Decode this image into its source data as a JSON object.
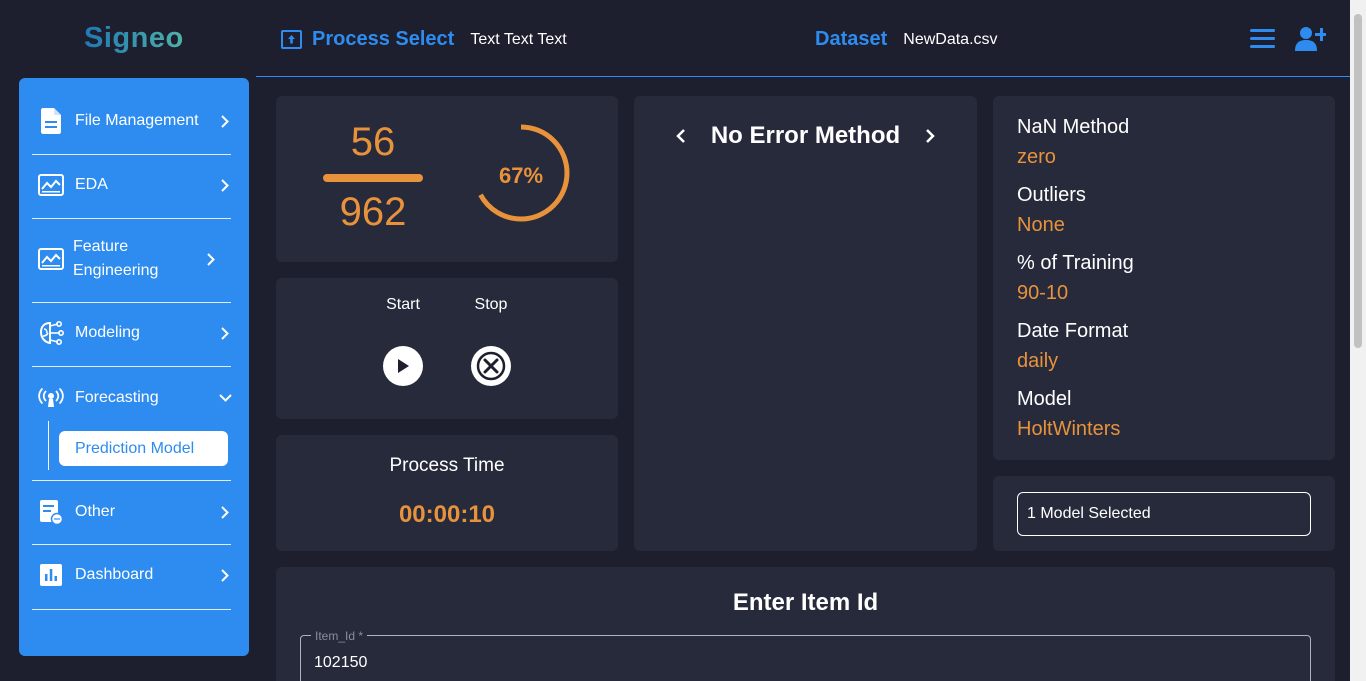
{
  "header": {
    "logo": "Signeo",
    "process_title": "Process Select",
    "process_sub": "Text Text Text",
    "dataset_label": "Dataset",
    "dataset_value": "NewData.csv",
    "menu_icon": "hamburger-menu-icon",
    "user_icon": "add-user-icon"
  },
  "sidebar": {
    "items": [
      {
        "label": "File Management",
        "icon": "file-icon"
      },
      {
        "label": "EDA",
        "icon": "chart-image-icon"
      },
      {
        "label": "Feature Engineering",
        "icon": "chart-image-icon"
      },
      {
        "label": "Modeling",
        "icon": "brain-network-icon"
      },
      {
        "label": "Forecasting",
        "icon": "broadcast-icon",
        "expanded": true
      },
      {
        "label": "Other",
        "icon": "form-chat-icon"
      },
      {
        "label": "Dashboard",
        "icon": "bar-chart-icon"
      }
    ],
    "subitem": "Prediction Model"
  },
  "progress": {
    "done": "56",
    "total": "962",
    "percent_label": "67%",
    "percent": 0.67
  },
  "controls": {
    "start_label": "Start",
    "stop_label": "Stop"
  },
  "process_time": {
    "title": "Process Time",
    "value": "00:00:10"
  },
  "error_method": {
    "title": "No Error Method"
  },
  "config": {
    "nan_label": "NaN Method",
    "nan_value": "zero",
    "outliers_label": "Outliers",
    "outliers_value": "None",
    "training_label": "% of Training",
    "training_value": "90-10",
    "date_label": "Date Format",
    "date_value": "daily",
    "model_label": "Model",
    "model_value": "HoltWinters"
  },
  "model_select": {
    "value": "1 Model Selected"
  },
  "item": {
    "title": "Enter Item Id",
    "field_label": "Item_Id *",
    "field_value": "102150"
  },
  "colors": {
    "accent": "#2e8cf0",
    "orange": "#e8923c",
    "background": "#1e1f2e",
    "card": "#262a3b"
  }
}
